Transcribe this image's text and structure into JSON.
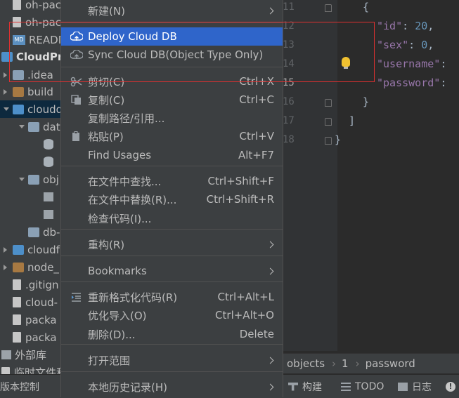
{
  "project_tree": {
    "items": [
      {
        "label": "oh-pac",
        "icon": "file-icon"
      },
      {
        "label": "oh-pac",
        "icon": "file-icon"
      },
      {
        "label": "READM",
        "icon": "markdown-icon"
      },
      {
        "label": "CloudPro",
        "icon": "module-icon"
      },
      {
        "label": ".idea",
        "icon": "folder-icon"
      },
      {
        "label": "build",
        "icon": "folder-icon"
      },
      {
        "label": "cloudd",
        "icon": "folder-icon"
      },
      {
        "label": "dat",
        "icon": "folder-icon"
      },
      {
        "label": "",
        "icon": "database-icon"
      },
      {
        "label": "",
        "icon": "database-icon"
      },
      {
        "label": "obj",
        "icon": "folder-icon"
      },
      {
        "label": "",
        "icon": "table-icon"
      },
      {
        "label": "",
        "icon": "table-icon"
      },
      {
        "label": "db-",
        "icon": "folder-icon"
      },
      {
        "label": "cloudf",
        "icon": "folder-icon"
      },
      {
        "label": "node_",
        "icon": "folder-icon"
      },
      {
        "label": ".gitign",
        "icon": "file-icon"
      },
      {
        "label": "cloud-",
        "icon": "file-icon"
      },
      {
        "label": "packa",
        "icon": "file-icon"
      },
      {
        "label": "packa",
        "icon": "file-icon"
      },
      {
        "label": "外部库",
        "icon": "library-icon"
      },
      {
        "label": "临时文件和",
        "icon": "scratch-icon"
      }
    ]
  },
  "context_menu": {
    "items": [
      {
        "label": "新建(N)",
        "mnemonic_label": "新建(<u>N</u>)",
        "shortcut": "",
        "submenu": true,
        "icon": ""
      },
      {
        "label": "Deploy Cloud DB",
        "shortcut": "",
        "submenu": false,
        "icon": "cloud-upload-icon",
        "highlighted": true
      },
      {
        "label": "Sync Cloud DB(Object Type Only)",
        "shortcut": "",
        "submenu": false,
        "icon": "cloud-sync-icon"
      },
      {
        "label": "剪切(C)",
        "shortcut": "Ctrl+X",
        "submenu": false,
        "icon": "scissors-icon"
      },
      {
        "label": "复制(C)",
        "shortcut": "Ctrl+C",
        "submenu": false,
        "icon": "copy-icon"
      },
      {
        "label": "复制路径/引用...",
        "shortcut": "",
        "submenu": false,
        "icon": ""
      },
      {
        "label": "粘贴(P)",
        "shortcut": "Ctrl+V",
        "submenu": false,
        "icon": "clipboard-icon"
      },
      {
        "label": "Find Usages",
        "shortcut": "Alt+F7",
        "submenu": false,
        "icon": ""
      },
      {
        "label": "在文件中查找...",
        "shortcut": "Ctrl+Shift+F",
        "submenu": false,
        "icon": ""
      },
      {
        "label": "在文件中替换(R)...",
        "shortcut": "Ctrl+Shift+R",
        "submenu": false,
        "icon": ""
      },
      {
        "label": "检查代码(I)...",
        "shortcut": "",
        "submenu": false,
        "icon": ""
      },
      {
        "label": "重构(R)",
        "shortcut": "",
        "submenu": true,
        "icon": ""
      },
      {
        "label": "Bookmarks",
        "shortcut": "",
        "submenu": true,
        "icon": ""
      },
      {
        "label": "重新格式化代码(R)",
        "shortcut": "Ctrl+Alt+L",
        "submenu": false,
        "icon": "reformat-icon"
      },
      {
        "label": "优化导入(O)",
        "shortcut": "Ctrl+Alt+O",
        "submenu": false,
        "icon": ""
      },
      {
        "label": "删除(D)...",
        "shortcut": "Delete",
        "submenu": false,
        "icon": ""
      },
      {
        "label": "打开范围",
        "shortcut": "",
        "submenu": true,
        "icon": ""
      },
      {
        "label": "本地历史记录(H)",
        "shortcut": "",
        "submenu": true,
        "icon": ""
      }
    ]
  },
  "editor": {
    "line_numbers": [
      "11",
      "12",
      "13",
      "14",
      "15",
      "16",
      "17",
      "18"
    ],
    "current_line": "15",
    "lines": [
      {
        "text": "{"
      },
      {
        "key": "\"id\"",
        "sep": ": ",
        "val": "20",
        "end": ","
      },
      {
        "key": "\"sex\"",
        "sep": ": ",
        "val": "0",
        "end": ","
      },
      {
        "key": "\"username\"",
        "sep": ": ",
        "val": "",
        "end": ""
      },
      {
        "key": "\"password\"",
        "sep": ": ",
        "val": "",
        "end": ""
      },
      {
        "text": "}"
      },
      {
        "text": "]"
      },
      {
        "text": "}"
      }
    ]
  },
  "breadcrumb": {
    "items": [
      "objects",
      "1",
      "password"
    ]
  },
  "bottom_bar": {
    "left_label": "版本控制",
    "build_label": "构建",
    "todo_label": "TODO",
    "log_label": "日志"
  },
  "colors": {
    "menu_highlight": "#2f65ca",
    "annotation_box": "#e03030",
    "json_key": "#9876aa",
    "json_number": "#6897bb"
  }
}
